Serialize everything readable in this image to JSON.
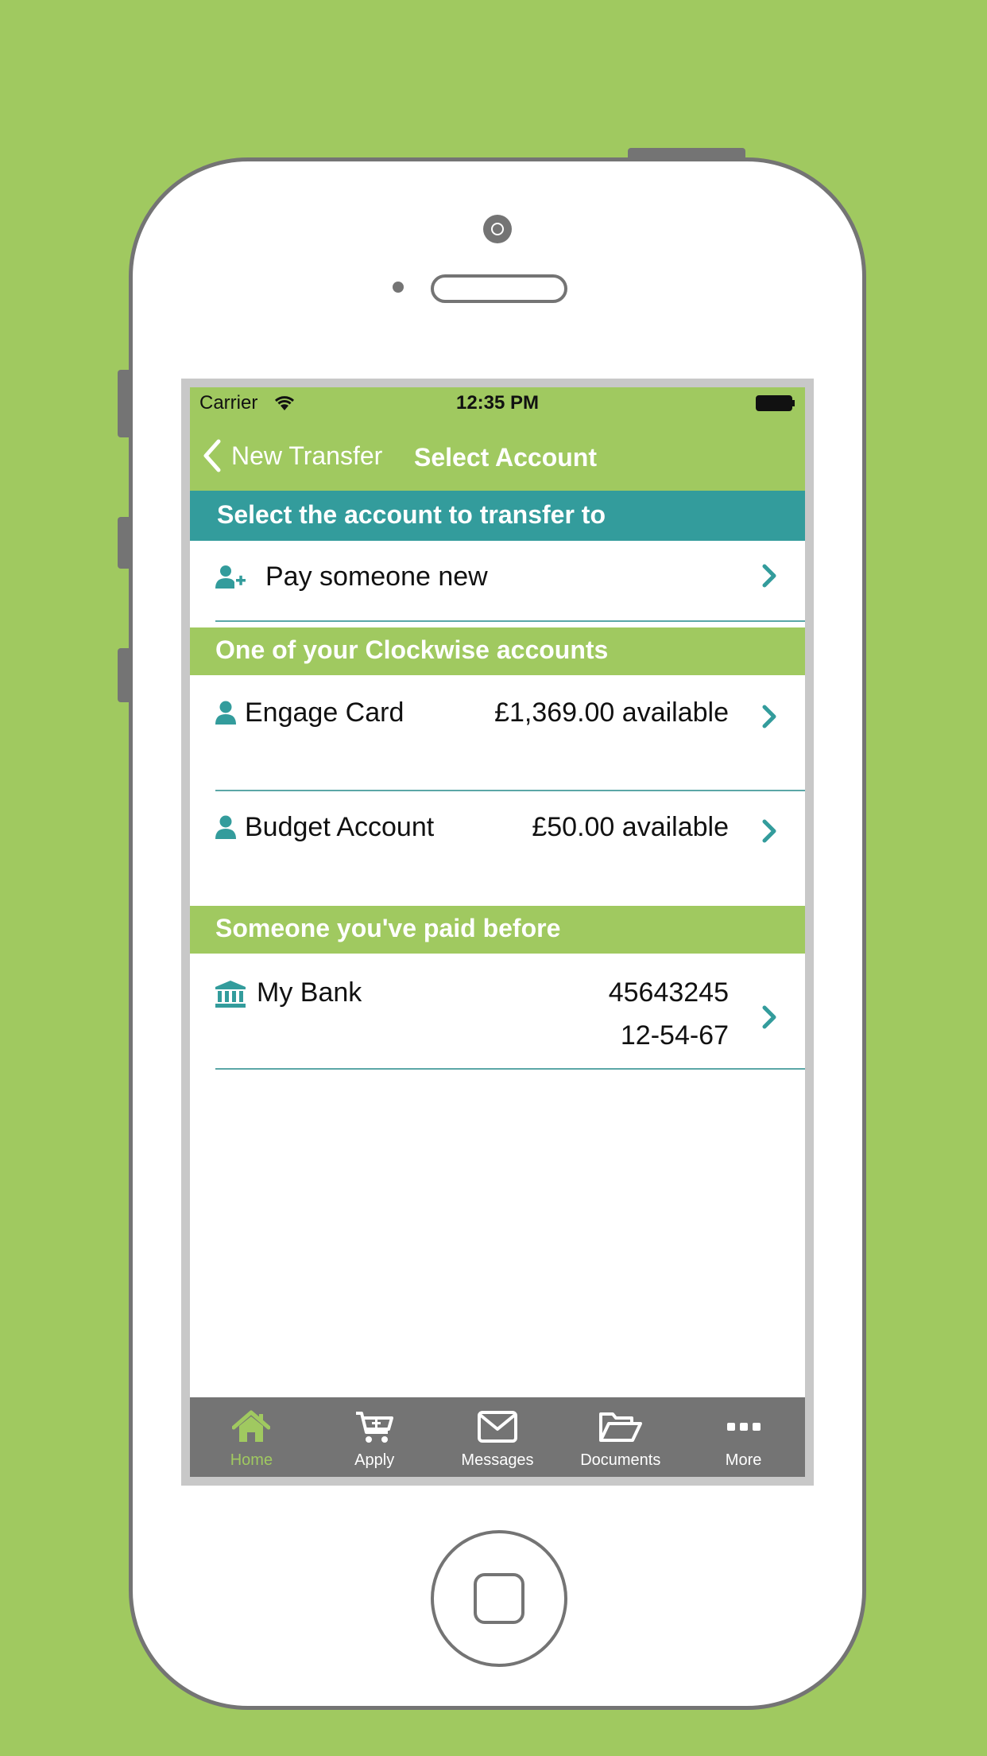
{
  "status": {
    "carrier": "Carrier",
    "time": "12:35 PM"
  },
  "nav": {
    "back_label": "New Transfer",
    "title": "Select Account"
  },
  "sections": {
    "transfer_to": "Select the account to transfer to",
    "clockwise": "One of your Clockwise accounts",
    "paid_before": "Someone you've paid before"
  },
  "pay_new": {
    "label": "Pay someone new"
  },
  "accounts": [
    {
      "name": "Engage Card",
      "available": "£1,369.00 available"
    },
    {
      "name": "Budget Account",
      "available": "£50.00 available"
    }
  ],
  "payees": [
    {
      "name": "My Bank",
      "account_number": "45643245",
      "sort_code": "12-54-67"
    }
  ],
  "tabs": [
    {
      "label": "Home",
      "icon": "home-icon",
      "active": true
    },
    {
      "label": "Apply",
      "icon": "cart-plus-icon",
      "active": false
    },
    {
      "label": "Messages",
      "icon": "envelope-icon",
      "active": false
    },
    {
      "label": "Documents",
      "icon": "folder-open-icon",
      "active": false
    },
    {
      "label": "More",
      "icon": "more-dots-icon",
      "active": false
    }
  ],
  "colors": {
    "background": "#a0c960",
    "teal": "#339c9c",
    "tabbar": "#747474",
    "frame": "#747474"
  }
}
